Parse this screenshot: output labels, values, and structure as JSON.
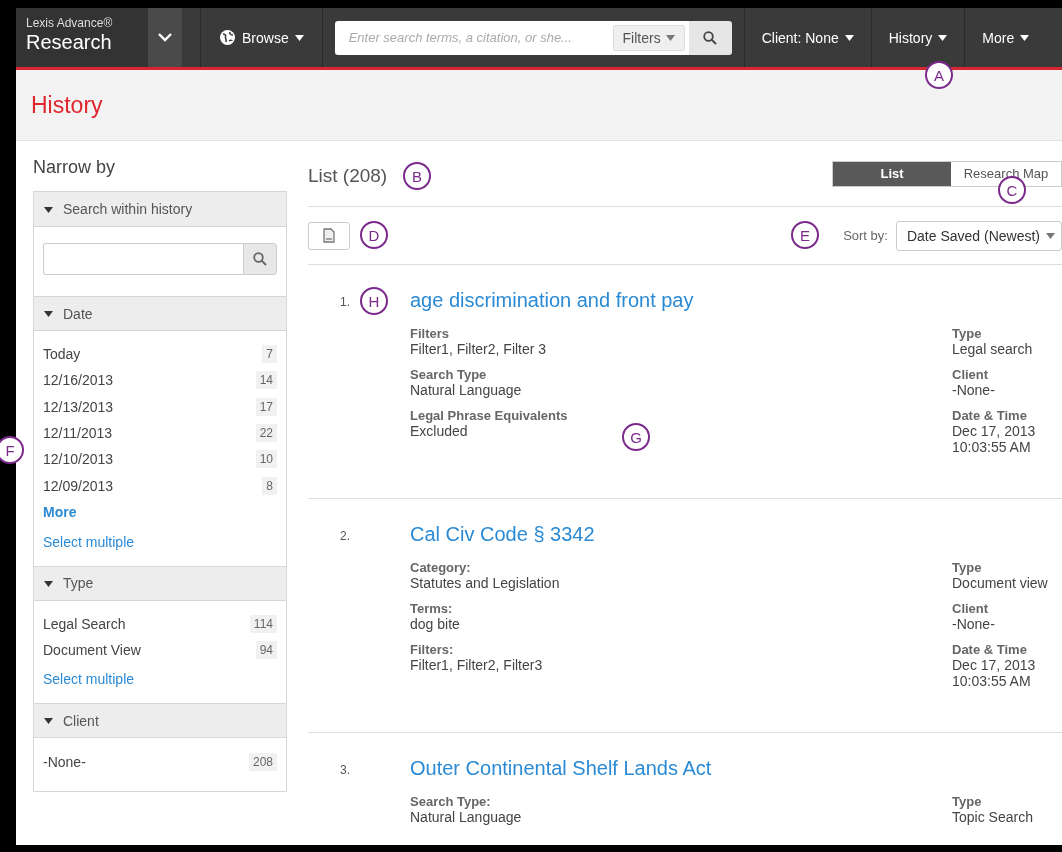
{
  "nav": {
    "brand_top": "Lexis Advance®",
    "brand_bottom": "Research",
    "browse": "Browse",
    "search_placeholder": "Enter search terms, a citation, or she...",
    "filters": "Filters",
    "client": "Client: None",
    "history": "History",
    "more": "More"
  },
  "page_title": "History",
  "sidebar": {
    "title": "Narrow by",
    "sections": [
      {
        "kind": "search",
        "title": "Search within history",
        "expanded": true
      },
      {
        "kind": "facets",
        "title": "Date",
        "expanded": true,
        "items": [
          {
            "label": "Today",
            "count": "7"
          },
          {
            "label": "12/16/2013",
            "count": "14"
          },
          {
            "label": "12/13/2013",
            "count": "17"
          },
          {
            "label": "12/11/2013",
            "count": "22"
          },
          {
            "label": "12/10/2013",
            "count": "10"
          },
          {
            "label": "12/09/2013",
            "count": "8"
          }
        ],
        "more": "More",
        "select": "Select multiple"
      },
      {
        "kind": "facets",
        "title": "Type",
        "expanded": true,
        "items": [
          {
            "label": "Legal Search",
            "count": "114"
          },
          {
            "label": "Document View",
            "count": "94"
          }
        ],
        "select": "Select multiple"
      },
      {
        "kind": "facets",
        "title": "Client",
        "expanded": true,
        "items": [
          {
            "label": "-None-",
            "count": "208"
          }
        ]
      }
    ]
  },
  "list_title": "List (208)",
  "view_toggle": [
    {
      "label": "List",
      "selected": true
    },
    {
      "label": "Research Map",
      "selected": false
    }
  ],
  "sort": {
    "label": "Sort by:",
    "value": "Date Saved (Newest)"
  },
  "results": [
    {
      "number": "1.",
      "title": "age discrimination and front pay",
      "left": [
        {
          "label": "Filters",
          "lines": [
            "Filter1, Filter2, Filter 3"
          ]
        },
        {
          "label": "Search Type",
          "lines": [
            "Natural Language"
          ]
        },
        {
          "label": "Legal Phrase Equivalents",
          "lines": [
            "Excluded"
          ]
        }
      ],
      "right": [
        {
          "label": "Type",
          "lines": [
            "Legal search"
          ]
        },
        {
          "label": "Client",
          "lines": [
            "-None-"
          ]
        },
        {
          "label": "Date & Time",
          "lines": [
            "Dec 17, 2013",
            "10:03:55 AM"
          ]
        }
      ]
    },
    {
      "number": "2.",
      "title": "Cal Civ Code § 3342",
      "left": [
        {
          "label": "Category:",
          "lines": [
            "Statutes and Legislation"
          ]
        },
        {
          "label": "Terms:",
          "lines": [
            "dog bite"
          ]
        },
        {
          "label": "Filters:",
          "lines": [
            "Filter1, Filter2, Filter3"
          ]
        }
      ],
      "right": [
        {
          "label": "Type",
          "lines": [
            "Document view"
          ]
        },
        {
          "label": "Client",
          "lines": [
            "-None-"
          ]
        },
        {
          "label": "Date & Time",
          "lines": [
            "Dec 17, 2013",
            "10:03:55 AM"
          ]
        }
      ]
    },
    {
      "number": "3.",
      "title": "Outer Continental Shelf Lands Act",
      "left": [
        {
          "label": "Search Type:",
          "lines": [
            "Natural Language"
          ]
        }
      ],
      "right": [
        {
          "label": "Type",
          "lines": [
            "Topic Search"
          ]
        }
      ]
    }
  ],
  "callouts": [
    {
      "letter": "A"
    },
    {
      "letter": "B"
    },
    {
      "letter": "C"
    },
    {
      "letter": "D"
    },
    {
      "letter": "E"
    },
    {
      "letter": "F"
    },
    {
      "letter": "G"
    },
    {
      "letter": "H"
    }
  ]
}
